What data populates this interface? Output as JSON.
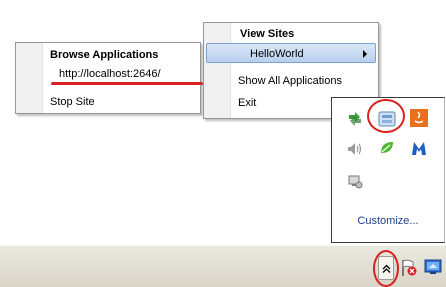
{
  "browse_menu": {
    "title": "Browse Applications",
    "url": "http://localhost:2646/",
    "stop_site": "Stop Site"
  },
  "sites_menu": {
    "title": "View Sites",
    "site": "HelloWorld",
    "show_all": "Show All Applications",
    "exit": "Exit"
  },
  "tray_panel": {
    "icons": [
      "green-arrows-icon",
      "iis-express-icon",
      "java-icon",
      "speaker-icon",
      "leaf-icon",
      "malwarebytes-icon",
      "network-icon"
    ],
    "customize": "Customize..."
  },
  "taskbar": {
    "icons": [
      "show-hidden-icons-chevron",
      "action-center-flag-icon",
      "monitor-icon"
    ]
  },
  "colors": {
    "highlight_red": "#d92121",
    "menu_hover": "#b9cfee",
    "link": "#1d3f8a"
  }
}
